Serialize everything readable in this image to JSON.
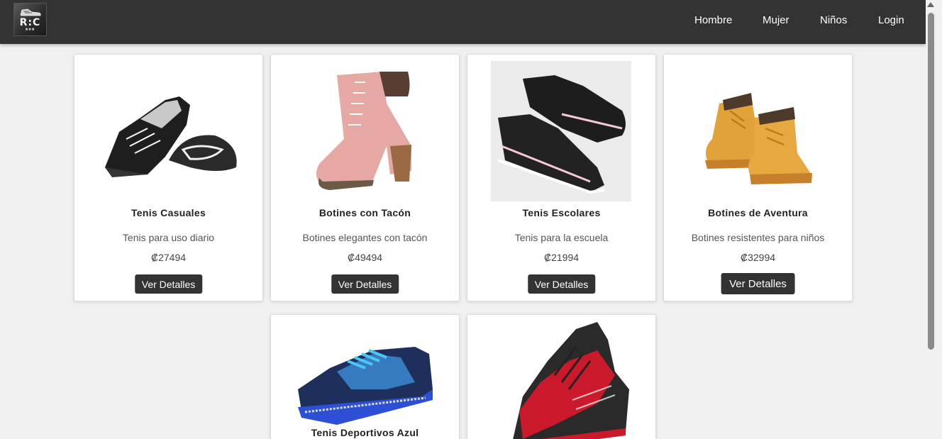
{
  "brand": {
    "logo_text": "R:C",
    "logo_sub": "■■■"
  },
  "nav": {
    "items": [
      "Hombre",
      "Mujer",
      "Niños",
      "Login"
    ]
  },
  "currency": "₡",
  "products": [
    {
      "name": "Tenis Casuales",
      "description": "Tenis para uso diario",
      "price": "₡27494",
      "button": "Ver Detalles",
      "color": "#1a1a1a"
    },
    {
      "name": "Botines con Tacón",
      "description": "Botines elegantes con tacón",
      "price": "₡49494",
      "button": "Ver Detalles",
      "color": "#e8a7a4"
    },
    {
      "name": "Tenis Escolares",
      "description": "Tenis para la escuela",
      "price": "₡21994",
      "button": "Ver Detalles",
      "color": "#222222"
    },
    {
      "name": "Botines de Aventura",
      "description": "Botines resistentes para niños",
      "price": "₡32994",
      "button": "Ver Detalles",
      "color": "#e3a43a"
    },
    {
      "name": "Tenis Deportivos Azul",
      "description": "",
      "price": "",
      "button": "",
      "color": "#1f4fa8"
    },
    {
      "name": "",
      "description": "",
      "price": "",
      "button": "",
      "color": "#c8182a"
    }
  ]
}
